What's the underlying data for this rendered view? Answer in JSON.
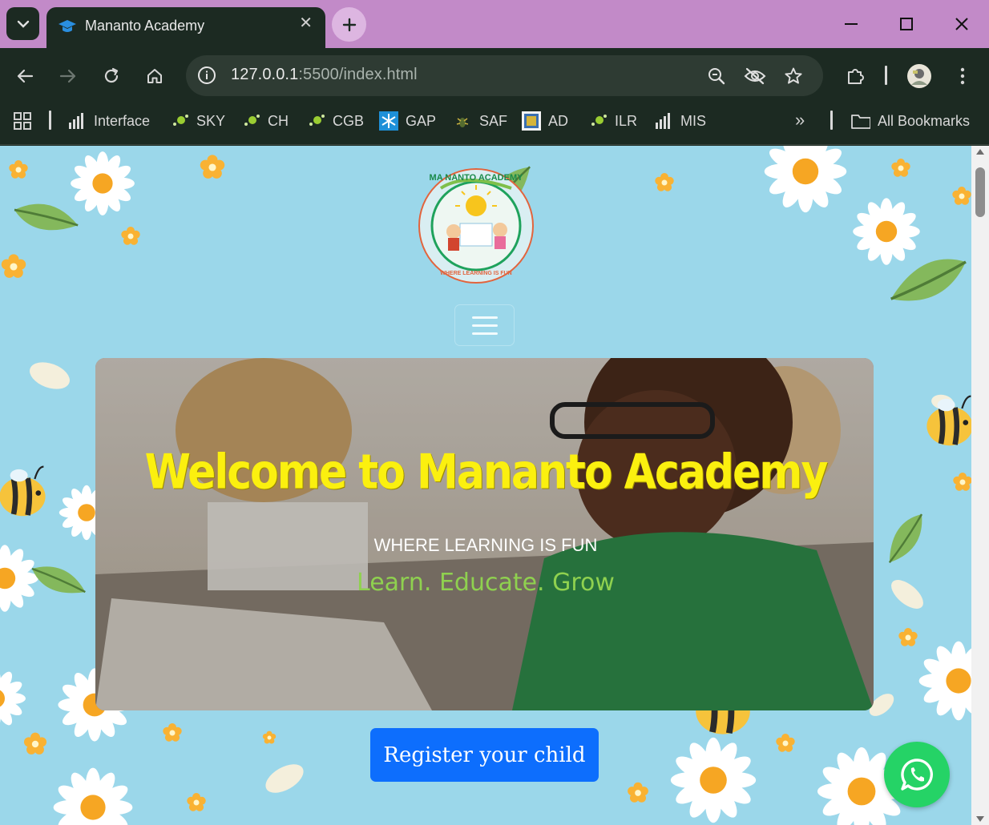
{
  "browser": {
    "tab_title": "Mananto Academy",
    "url_host": "127.0.0.1",
    "url_rest": ":5500/index.html",
    "bookmarks": [
      "Interface",
      "SKY",
      "CH",
      "CGB",
      "GAP",
      "SAF",
      "AD",
      "ILR",
      "MIS"
    ],
    "all_bookmarks_label": "All Bookmarks"
  },
  "page": {
    "logo_top_text": "MA NANTO ACADEMY",
    "logo_bottom_text": "WHERE LEARNING IS FUN",
    "hero_title": "Welcome to Mananto Academy",
    "hero_subtitle": "WHERE LEARNING IS FUN",
    "hero_tagline": "Learn. Educate. Grow",
    "register_button": "Register your child"
  },
  "colors": {
    "page_bg": "#9bd7ea",
    "hero_title": "#fbf00f",
    "tagline": "#8fd14f",
    "button": "#0d6efd",
    "whatsapp": "#25d366",
    "titlebar": "#c28ac8"
  },
  "icons": {
    "tab_search": "chevron-down-icon",
    "favicon": "graduation-cap-icon",
    "new_tab": "plus-icon",
    "back": "arrow-left-icon",
    "forward": "arrow-right-icon",
    "reload": "reload-icon",
    "home": "home-icon",
    "zoom": "zoom-icon",
    "eye_off": "eye-off-icon",
    "star": "star-icon",
    "extensions": "puzzle-icon",
    "menu": "kebab-menu-icon",
    "whatsapp": "whatsapp-icon"
  }
}
